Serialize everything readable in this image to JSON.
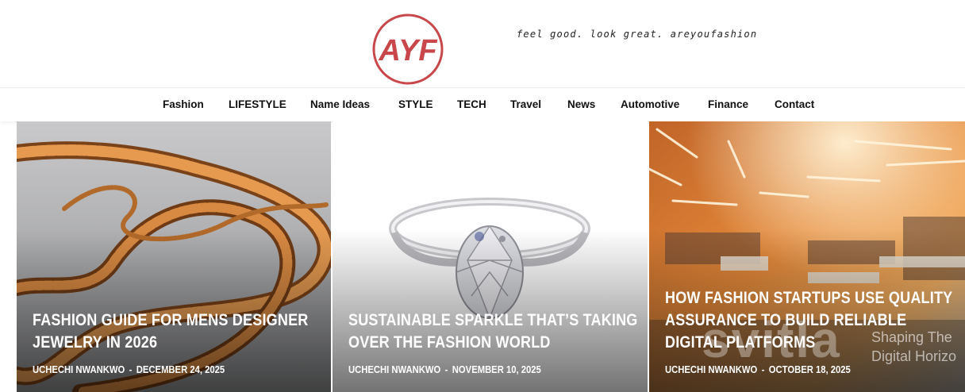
{
  "header": {
    "logo_text": "AYF",
    "tagline": "feel good. look great. areyoufashion",
    "brand_color": "#c9474b"
  },
  "nav": {
    "items": [
      {
        "label": "Fashion"
      },
      {
        "label": "LIFESTYLE"
      },
      {
        "label": "Name Ideas"
      },
      {
        "label": "STYLE"
      },
      {
        "label": "TECH"
      },
      {
        "label": "Travel"
      },
      {
        "label": "News"
      },
      {
        "label": "Automotive"
      },
      {
        "label": "Finance"
      },
      {
        "label": "Contact"
      }
    ]
  },
  "articles": [
    {
      "title": "FASHION GUIDE FOR MENS DESIGNER JEWELRY IN 2026",
      "author": "UCHECHI NWANKWO",
      "date": "DECEMBER 24, 2025",
      "image": "gold-chain-image"
    },
    {
      "title": "SUSTAINABLE SPARKLE THAT’S TAKING OVER THE FASHION WORLD",
      "author": "UCHECHI NWANKWO",
      "date": "NOVEMBER 10, 2025",
      "image": "diamond-ring-image"
    },
    {
      "title": "HOW FASHION STARTUPS USE QUALITY ASSURANCE TO BUILD RELIABLE DIGITAL PLATFORMS",
      "author": "UCHECHI NWANKWO",
      "date": "OCTOBER 18, 2025",
      "image": "office-image",
      "image_overlay": {
        "brand": "svitla",
        "slogan_line1": "Shaping The",
        "slogan_line2": "Digital Horizo"
      }
    }
  ],
  "meta_separator": "-"
}
